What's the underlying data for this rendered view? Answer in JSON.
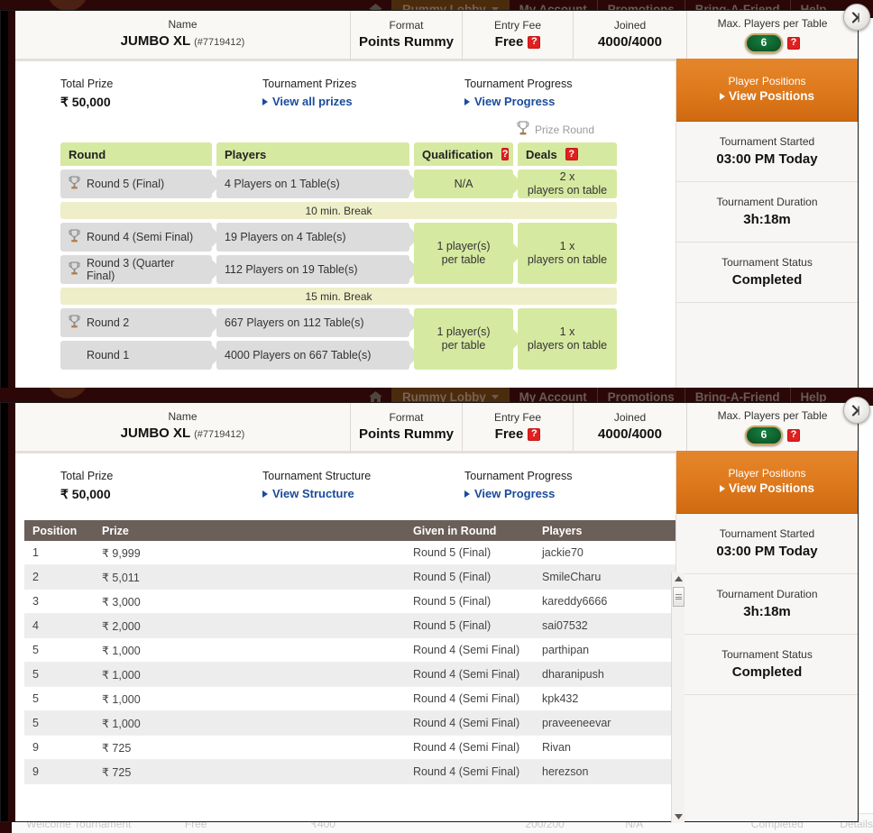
{
  "nav": {
    "home_icon": "home-icon",
    "items": [
      {
        "label": "Rummy Lobby",
        "has_caret": true,
        "active": true
      },
      {
        "label": "My Account",
        "has_caret": false,
        "active": false
      },
      {
        "label": "Promotions",
        "has_caret": false,
        "active": false
      },
      {
        "label": "Bring-A-Friend",
        "has_caret": false,
        "active": false
      },
      {
        "label": "Help",
        "has_caret": false,
        "active": false
      }
    ]
  },
  "header": {
    "name_label": "Name",
    "name_value": "JUMBO XL",
    "name_id": "(#7719412)",
    "format_label": "Format",
    "format_value": "Points Rummy",
    "fee_label": "Entry Fee",
    "fee_value": "Free",
    "fee_help": "?",
    "joined_label": "Joined",
    "joined_value": "4000/4000",
    "maxp_label": "Max. Players per Table",
    "maxp_value": "6",
    "maxp_help": "?"
  },
  "sidebar": {
    "cta_label": "Player Positions",
    "cta_link": "View Positions",
    "blocks": [
      {
        "label": "Tournament Started",
        "value": "03:00 PM Today"
      },
      {
        "label": "Tournament Duration",
        "value": "3h:18m"
      },
      {
        "label": "Tournament Status",
        "value": "Completed"
      }
    ]
  },
  "panel_top": {
    "summary": [
      {
        "label": "Total Prize",
        "value": "₹ 50,000",
        "type": "value"
      },
      {
        "label": "Tournament Prizes",
        "value": "View all prizes",
        "type": "link"
      },
      {
        "label": "Tournament Progress",
        "value": "View Progress",
        "type": "link"
      }
    ],
    "prize_round_legend": "Prize Round",
    "columns": {
      "round": "Round",
      "players": "Players",
      "qualification": "Qualification",
      "qualification_help": "?",
      "deals": "Deals",
      "deals_help": "?"
    },
    "groups": [
      {
        "rows": [
          {
            "round": "Round 5 (Final)",
            "trophy": true,
            "players": "4 Players on 1 Table(s)"
          }
        ],
        "qualification": "N/A",
        "qualification_multiline": false,
        "deals_top": "2 x",
        "deals_bottom": "players on table"
      },
      {
        "break": "10 min. Break"
      },
      {
        "rows": [
          {
            "round": "Round 4 (Semi Final)",
            "trophy": true,
            "players": "19 Players on 4 Table(s)"
          },
          {
            "round": "Round 3 (Quarter Final)",
            "trophy": true,
            "players": "112 Players on 19 Table(s)"
          }
        ],
        "qual_top": "1 player(s)",
        "qual_bottom": "per table",
        "deals_top": "1 x",
        "deals_bottom": "players on table"
      },
      {
        "break": "15 min. Break"
      },
      {
        "rows": [
          {
            "round": "Round 2",
            "trophy": true,
            "players": "667 Players on 112 Table(s)"
          },
          {
            "round": "Round 1",
            "trophy": false,
            "players": "4000 Players on 667 Table(s)"
          }
        ],
        "qual_top": "1 player(s)",
        "qual_bottom": "per table",
        "deals_top": "1 x",
        "deals_bottom": "players on table"
      }
    ]
  },
  "panel_bottom": {
    "summary": [
      {
        "label": "Total Prize",
        "value": "₹ 50,000",
        "type": "value"
      },
      {
        "label": "Tournament Structure",
        "value": "View Structure",
        "type": "link"
      },
      {
        "label": "Tournament Progress",
        "value": "View Progress",
        "type": "link"
      }
    ],
    "table": {
      "columns": [
        "Position",
        "Prize",
        "Given in Round",
        "Players"
      ],
      "rows": [
        [
          "1",
          "₹ 9,999",
          "Round 5 (Final)",
          "jackie70"
        ],
        [
          "2",
          "₹ 5,011",
          "Round 5 (Final)",
          "SmileCharu"
        ],
        [
          "3",
          "₹ 3,000",
          "Round 5 (Final)",
          "kareddy6666"
        ],
        [
          "4",
          "₹ 2,000",
          "Round 5 (Final)",
          "sai07532"
        ],
        [
          "5",
          "₹ 1,000",
          "Round 4 (Semi Final)",
          "parthipan"
        ],
        [
          "5",
          "₹ 1,000",
          "Round 4 (Semi Final)",
          "dharanipush"
        ],
        [
          "5",
          "₹ 1,000",
          "Round 4 (Semi Final)",
          "kpk432"
        ],
        [
          "5",
          "₹ 1,000",
          "Round 4 (Semi Final)",
          "praveeneevar"
        ],
        [
          "9",
          "₹ 725",
          "Round 4 (Semi Final)",
          "Rivan"
        ],
        [
          "9",
          "₹ 725",
          "Round 4 (Semi Final)",
          "herezson"
        ]
      ]
    }
  },
  "background_row": {
    "name": "Welcome Tournament",
    "fee": "Free",
    "prize": "₹400",
    "joined": "200/200",
    "qual": "N/A",
    "status": "Completed",
    "details": "Details"
  },
  "colors": {
    "nav_bg": "#2b0707",
    "accent_orange": "#e07b1e",
    "header_green": "#d6e9a1",
    "row_grey": "#dcdcdc",
    "break_yellow": "#eeeec8",
    "table_header": "#6b5f59",
    "link_blue": "#1a4b9c",
    "help_red": "#e02020"
  }
}
